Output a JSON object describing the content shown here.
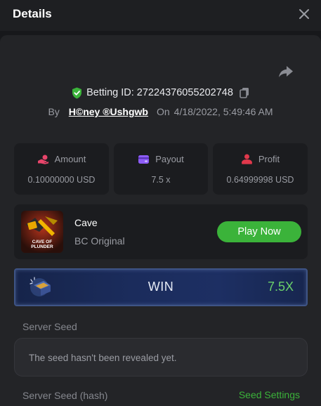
{
  "header": {
    "title": "Details"
  },
  "bet": {
    "label": "Betting ID:",
    "id": "27224376055202748",
    "by_label": "By",
    "username": "H©ney ®Ushgwb",
    "on_label": "On",
    "datetime": "4/18/2022, 5:49:46 AM"
  },
  "stats": {
    "amount": {
      "label": "Amount",
      "value": "0.10000000 USD"
    },
    "payout": {
      "label": "Payout",
      "value": "7.5 x"
    },
    "profit": {
      "label": "Profit",
      "value": "0.64999998 USD"
    }
  },
  "game": {
    "name": "Cave",
    "provider": "BC Original",
    "thumb_caption_1": "CAVE OF",
    "thumb_caption_2": "PLUNDER",
    "play_label": "Play Now"
  },
  "result": {
    "label": "WIN",
    "multiplier": "7.5X"
  },
  "seeds": {
    "server_seed_label": "Server Seed",
    "server_seed_value": "The seed hasn't been revealed yet.",
    "server_seed_hash_label": "Server Seed (hash)",
    "seed_settings_label": "Seed Settings"
  },
  "colors": {
    "accent_green": "#3bb33a",
    "amount_icon": "#e8456b",
    "payout_icon": "#8d5cf6",
    "profit_icon": "#e0384b",
    "win_multiplier": "#6ad06a"
  },
  "icons": {
    "close": "close-icon",
    "share": "share-icon",
    "verified": "shield-check-icon",
    "copy": "copy-icon",
    "amount": "coins-hand-icon",
    "payout": "wallet-icon",
    "profit": "user-profit-icon",
    "win": "treasure-chest-icon"
  }
}
